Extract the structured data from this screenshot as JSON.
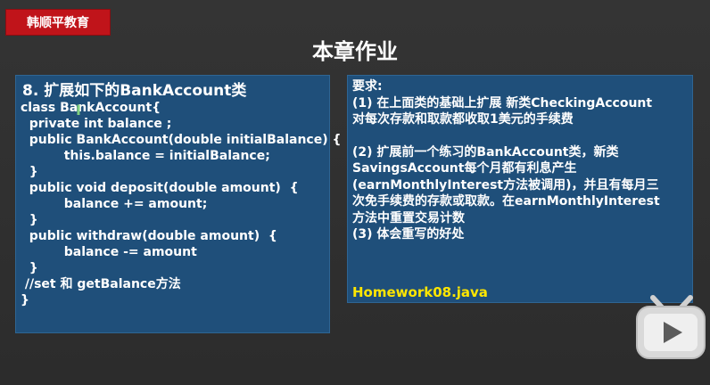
{
  "brand": {
    "text": "韩顺平教育"
  },
  "title": "本章作业",
  "left_panel": {
    "heading": "8. 扩展如下的BankAccount类",
    "code": [
      "class BankAccount{",
      "  private int balance ;",
      "  public BankAccount(double initialBalance) {",
      "          this.balance = initialBalance;",
      "  }",
      "",
      "  public void deposit(double amount)  {",
      "          balance += amount;",
      "  }",
      "",
      "  public withdraw(double amount)  {",
      "          balance -= amount",
      "  }",
      " //set 和 getBalance方法",
      "}"
    ]
  },
  "right_panel": {
    "lines": [
      "要求:",
      "(1) 在上面类的基础上扩展 新类CheckingAccount",
      "对每次存款和取款都收取1美元的手续费",
      "",
      "(2) 扩展前一个练习的BankAccount类，新类",
      "SavingsAccount每个月都有利息产生",
      "(earnMonthlyInterest方法被调用)，并且有每月三",
      "次免手续费的存款或取款。在earnMonthlyInterest",
      "方法中重置交易计数",
      "(3) 体会重写的好处"
    ],
    "file": "Homework08.java"
  },
  "colors": {
    "background": "#2f2f2f",
    "brand": "#c0141a",
    "panel": "#1f4f7a",
    "file_highlight": "#ffe600"
  },
  "icons": {
    "player": "bilibili-tv-icon",
    "cursor": "text-cursor-icon"
  }
}
